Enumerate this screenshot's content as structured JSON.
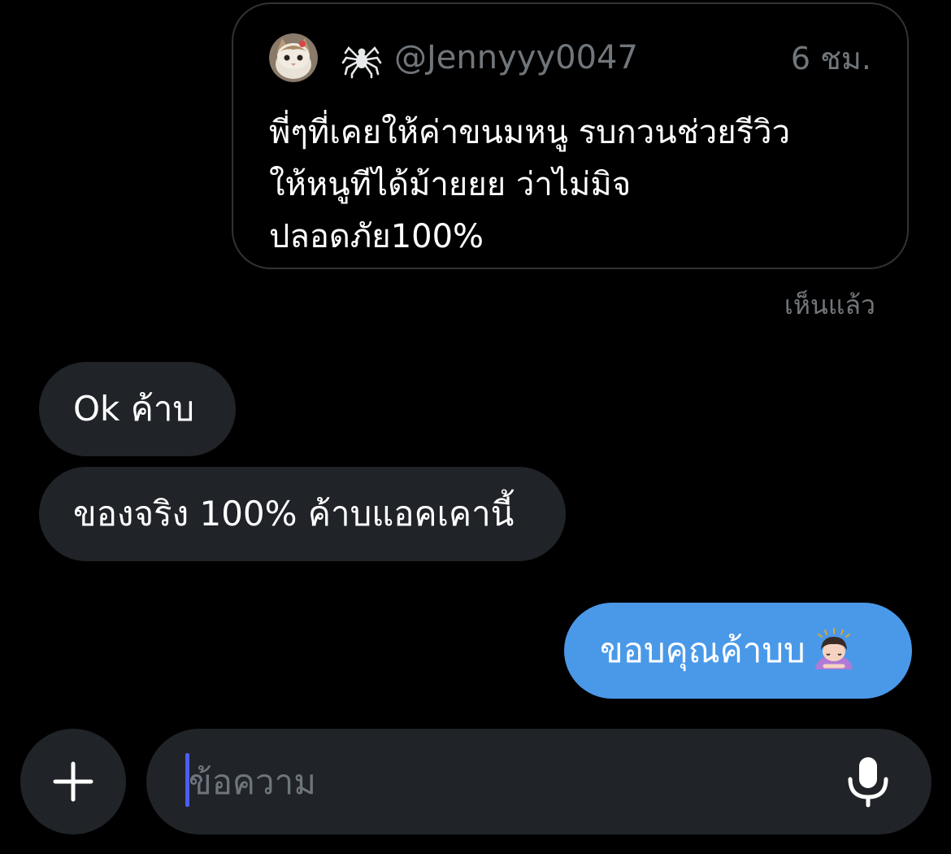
{
  "quote": {
    "handle": "@Jennyyy0047",
    "time": "6 ชม.",
    "text_lines": [
      "พี่ๆที่เคยให้ค่าขนมหนู รบกวนช่วยรีวิว",
      "ให้หนูทีได้ม้ายยย ว่าไม่มิจ",
      "ปลอดภัย100%"
    ],
    "avatar_icon": "cat-avatar",
    "badge_icon": "spider-icon"
  },
  "seen_label": "เห็นแล้ว",
  "messages": [
    {
      "direction": "incoming",
      "text": "Ok ค้าบ"
    },
    {
      "direction": "incoming",
      "text": "ของจริง 100% ค้าบแอคเคานี้"
    },
    {
      "direction": "outgoing",
      "text": "ขอบคุณค้าบบ",
      "emoji_icon": "person-bowing-emoji"
    }
  ],
  "composer": {
    "placeholder": "ข้อความ",
    "add_icon": "plus-icon",
    "mic_icon": "microphone-icon"
  },
  "colors": {
    "background": "#000000",
    "incoming_bubble": "#202327",
    "outgoing_bubble": "#4a99e9",
    "secondary_text": "#71767b",
    "caret": "#4b5ff0"
  }
}
